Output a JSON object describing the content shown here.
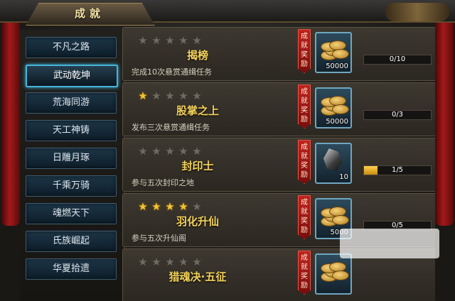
{
  "header": {
    "title": "成就",
    "close_icon": "close-icon"
  },
  "sidebar": {
    "items": [
      {
        "label": "不凡之路",
        "active": false
      },
      {
        "label": "武动乾坤",
        "active": true
      },
      {
        "label": "荒海同游",
        "active": false
      },
      {
        "label": "天工神铸",
        "active": false
      },
      {
        "label": "日雕月琢",
        "active": false
      },
      {
        "label": "千乘万骑",
        "active": false
      },
      {
        "label": "魂燃天下",
        "active": false
      },
      {
        "label": "氏族崛起",
        "active": false
      },
      {
        "label": "华夏拾遗",
        "active": false
      }
    ]
  },
  "achievements": [
    {
      "name": "揭榜",
      "description": "完成10次悬赏通缉任务",
      "stars_lit": 0,
      "stars_total": 5,
      "reward_tag": "成就奖励",
      "reward_type": "coins",
      "reward_count": "50000",
      "progress_text": "0/10",
      "progress_fraction": 0
    },
    {
      "name": "股掌之上",
      "description": "发布三次悬赏通缉任务",
      "stars_lit": 1,
      "stars_total": 5,
      "reward_tag": "成就奖励",
      "reward_type": "coins",
      "reward_count": "50000",
      "progress_text": "0/3",
      "progress_fraction": 0
    },
    {
      "name": "封印士",
      "description": "参与五次封印之地",
      "stars_lit": 0,
      "stars_total": 5,
      "reward_tag": "成就奖励",
      "reward_type": "shard",
      "reward_count": "10",
      "progress_text": "1/5",
      "progress_fraction": 0.2
    },
    {
      "name": "羽化升仙",
      "description": "参与五次升仙阁",
      "stars_lit": 4,
      "stars_total": 5,
      "reward_tag": "成就奖励",
      "reward_type": "coins",
      "reward_count": "5000",
      "progress_text": "0/5",
      "progress_fraction": 0
    },
    {
      "name": "猎魂决·五征",
      "description": "",
      "stars_lit": 0,
      "stars_total": 5,
      "reward_tag": "成就奖励",
      "reward_type": "coins",
      "reward_count": "",
      "progress_text": "",
      "progress_fraction": 0
    }
  ],
  "colors": {
    "star_lit": "#f3c431",
    "star_dim": "#6f6b63",
    "name": "#f4d25a",
    "active_border": "#47b4d8",
    "reward_tag": "#c0221f",
    "progress_fill": "#ffd24a"
  }
}
